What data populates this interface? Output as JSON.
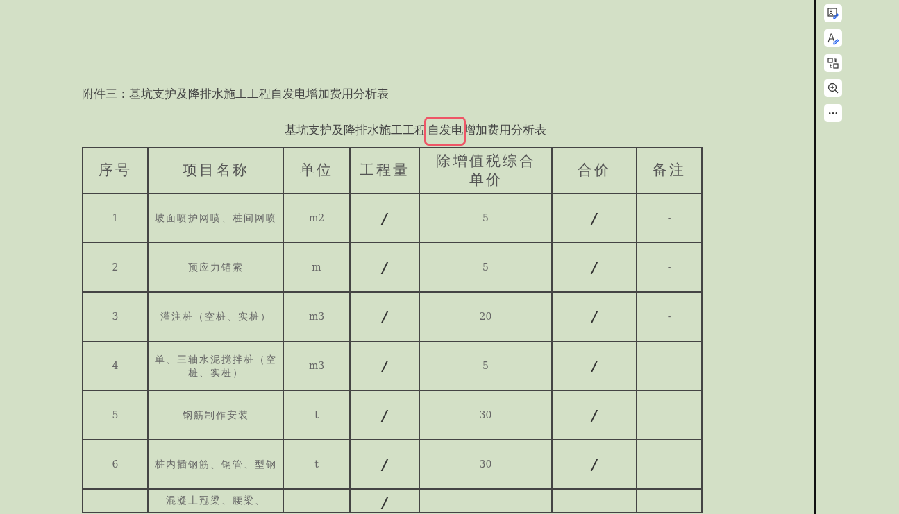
{
  "document": {
    "heading": "附件三：基坑支护及降排水施工工程自发电增加费用分析表",
    "subtitle": [
      {
        "text": "基坑支护及降排水施工工程",
        "highlighted": false
      },
      {
        "text": "自发电",
        "highlighted": true
      },
      {
        "text": "增加费用分析表",
        "highlighted": false
      }
    ],
    "table": {
      "columns": [
        "序号",
        "项目名称",
        "单位",
        "工程量",
        "除增值税综合单价",
        "合价",
        "备注"
      ],
      "rows": [
        {
          "no": "1",
          "name": "坡面喷护网喷、桩间网喷",
          "unit": "m2",
          "quantity": "/",
          "unit_price": "5",
          "total": "/",
          "remark": "-"
        },
        {
          "no": "2",
          "name": "预应力锚索",
          "unit": "m",
          "quantity": "/",
          "unit_price": "5",
          "total": "/",
          "remark": "-"
        },
        {
          "no": "3",
          "name": "灌注桩（空桩、实桩）",
          "unit": "m3",
          "quantity": "/",
          "unit_price": "20",
          "total": "/",
          "remark": "-"
        },
        {
          "no": "4",
          "name": "单、三轴水泥搅拌桩（空桩、实桩）",
          "unit": "m3",
          "quantity": "/",
          "unit_price": "5",
          "total": "/"
        },
        {
          "no": "5",
          "name": "钢筋制作安装",
          "unit": "t",
          "quantity": "/",
          "unit_price": "30",
          "total": "/"
        },
        {
          "no": "6",
          "name": "桩内插钢筋、钢管、型钢",
          "unit": "t",
          "quantity": "/",
          "unit_price": "30",
          "total": "/"
        },
        {
          "name": "混凝土冠梁、腰梁、",
          "quantity": "/"
        }
      ]
    }
  },
  "toolbar": [
    {
      "kind": "image-edit"
    },
    {
      "kind": "text-edit"
    },
    {
      "kind": "convert"
    },
    {
      "kind": "zoom"
    },
    {
      "kind": "more"
    }
  ]
}
